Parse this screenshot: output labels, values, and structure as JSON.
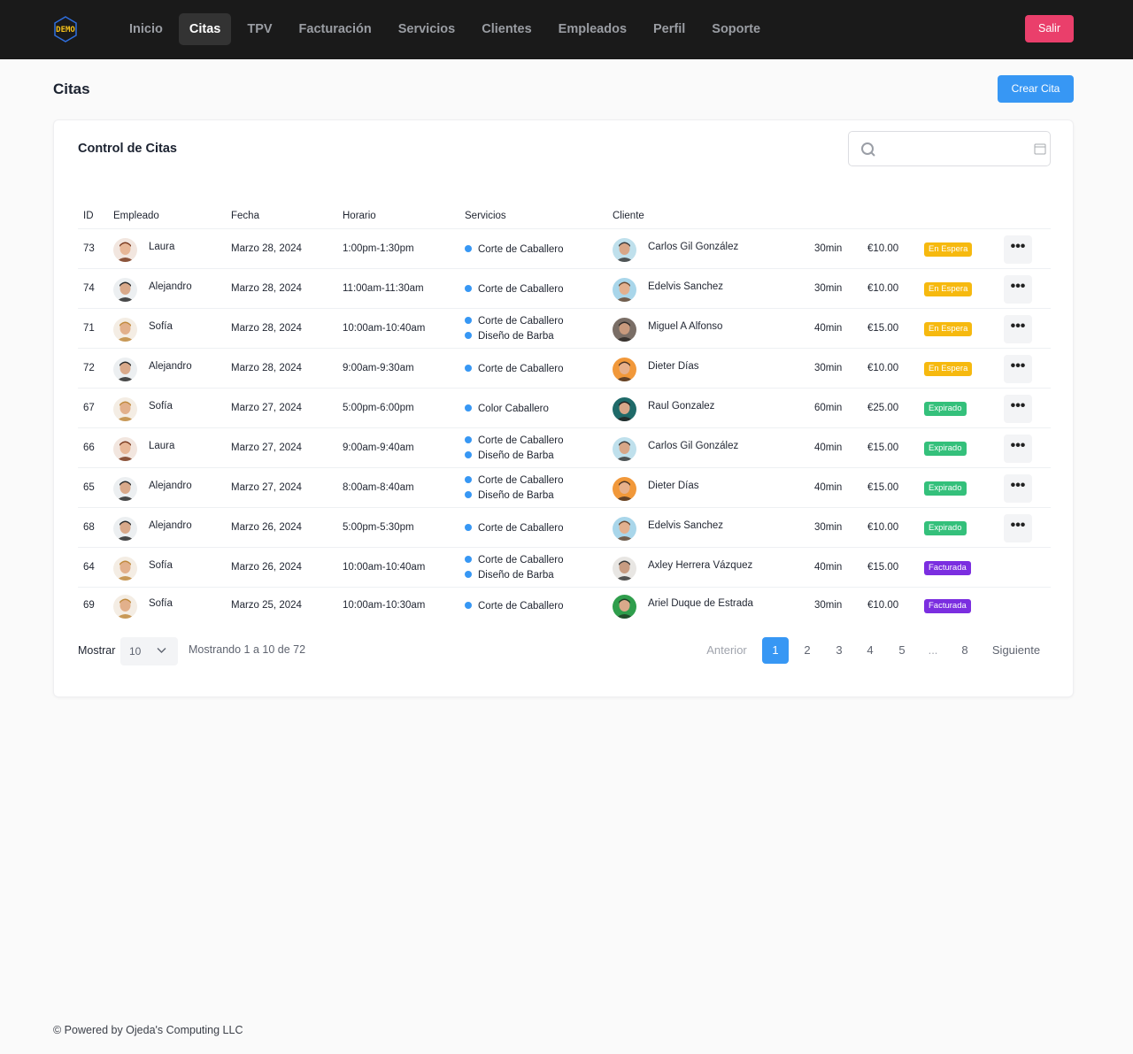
{
  "nav": {
    "logo_text": "DEMO",
    "items": [
      {
        "label": "Inicio",
        "active": false
      },
      {
        "label": "Citas",
        "active": true
      },
      {
        "label": "TPV",
        "active": false
      },
      {
        "label": "Facturación",
        "active": false
      },
      {
        "label": "Servicios",
        "active": false
      },
      {
        "label": "Clientes",
        "active": false
      },
      {
        "label": "Empleados",
        "active": false
      },
      {
        "label": "Perfil",
        "active": false
      },
      {
        "label": "Soporte",
        "active": false
      }
    ],
    "logout_label": "Salir"
  },
  "page": {
    "title": "Citas",
    "create_button": "Crear Cita"
  },
  "card": {
    "title": "Control de Citas",
    "search": {
      "value": "",
      "placeholder": ""
    }
  },
  "table": {
    "headers": {
      "id": "ID",
      "empleado": "Empleado",
      "fecha": "Fecha",
      "horario": "Horario",
      "servicios": "Servicios",
      "cliente": "Cliente"
    },
    "rows": [
      {
        "id": "73",
        "empleado": "Laura",
        "fecha": "Marzo 28, 2024",
        "horario": "1:00pm-1:30pm",
        "servicios": [
          "Corte de Caballero"
        ],
        "cliente": "Carlos Gil González",
        "duracion": "30min",
        "precio": "€10.00",
        "estado": "En Espera",
        "estado_tipo": "espera",
        "acciones": true
      },
      {
        "id": "74",
        "empleado": "Alejandro",
        "fecha": "Marzo 28, 2024",
        "horario": "11:00am-11:30am",
        "servicios": [
          "Corte de Caballero"
        ],
        "cliente": "Edelvis Sanchez",
        "duracion": "30min",
        "precio": "€10.00",
        "estado": "En Espera",
        "estado_tipo": "espera",
        "acciones": true
      },
      {
        "id": "71",
        "empleado": "Sofía",
        "fecha": "Marzo 28, 2024",
        "horario": "10:00am-10:40am",
        "servicios": [
          "Corte de Caballero",
          "Diseño de Barba"
        ],
        "cliente": "Miguel A Alfonso",
        "duracion": "40min",
        "precio": "€15.00",
        "estado": "En Espera",
        "estado_tipo": "espera",
        "acciones": true
      },
      {
        "id": "72",
        "empleado": "Alejandro",
        "fecha": "Marzo 28, 2024",
        "horario": "9:00am-9:30am",
        "servicios": [
          "Corte de Caballero"
        ],
        "cliente": "Dieter Días",
        "duracion": "30min",
        "precio": "€10.00",
        "estado": "En Espera",
        "estado_tipo": "espera",
        "acciones": true
      },
      {
        "id": "67",
        "empleado": "Sofía",
        "fecha": "Marzo 27, 2024",
        "horario": "5:00pm-6:00pm",
        "servicios": [
          "Color Caballero"
        ],
        "cliente": "Raul Gonzalez",
        "duracion": "60min",
        "precio": "€25.00",
        "estado": "Expirado",
        "estado_tipo": "expirado",
        "acciones": true
      },
      {
        "id": "66",
        "empleado": "Laura",
        "fecha": "Marzo 27, 2024",
        "horario": "9:00am-9:40am",
        "servicios": [
          "Corte de Caballero",
          "Diseño de Barba"
        ],
        "cliente": "Carlos Gil González",
        "duracion": "40min",
        "precio": "€15.00",
        "estado": "Expirado",
        "estado_tipo": "expirado",
        "acciones": true
      },
      {
        "id": "65",
        "empleado": "Alejandro",
        "fecha": "Marzo 27, 2024",
        "horario": "8:00am-8:40am",
        "servicios": [
          "Corte de Caballero",
          "Diseño de Barba"
        ],
        "cliente": "Dieter Días",
        "duracion": "40min",
        "precio": "€15.00",
        "estado": "Expirado",
        "estado_tipo": "expirado",
        "acciones": true
      },
      {
        "id": "68",
        "empleado": "Alejandro",
        "fecha": "Marzo 26, 2024",
        "horario": "5:00pm-5:30pm",
        "servicios": [
          "Corte de Caballero"
        ],
        "cliente": "Edelvis Sanchez",
        "duracion": "30min",
        "precio": "€10.00",
        "estado": "Expirado",
        "estado_tipo": "expirado",
        "acciones": true
      },
      {
        "id": "64",
        "empleado": "Sofía",
        "fecha": "Marzo 26, 2024",
        "horario": "10:00am-10:40am",
        "servicios": [
          "Corte de Caballero",
          "Diseño de Barba"
        ],
        "cliente": "Axley Herrera Vázquez",
        "duracion": "40min",
        "precio": "€15.00",
        "estado": "Facturada",
        "estado_tipo": "facturada",
        "acciones": false
      },
      {
        "id": "69",
        "empleado": "Sofía",
        "fecha": "Marzo 25, 2024",
        "horario": "10:00am-10:30am",
        "servicios": [
          "Corte de Caballero"
        ],
        "cliente": "Ariel Duque de Estrada",
        "duracion": "30min",
        "precio": "€10.00",
        "estado": "Facturada",
        "estado_tipo": "facturada",
        "acciones": false
      }
    ]
  },
  "pagination": {
    "show_label": "Mostrar",
    "page_size": "10",
    "info": "Mostrando 1 a 10 de 72",
    "prev": "Anterior",
    "pages": [
      "1",
      "2",
      "3",
      "4",
      "5",
      "...",
      "8"
    ],
    "current": "1",
    "next": "Siguiente"
  },
  "footer": {
    "text": "© Powered by Ojeda's Computing LLC"
  },
  "colors": {
    "accent": "#3797f4",
    "danger": "#ea3f6b",
    "waiting": "#f6b90f",
    "expired": "#34c07b",
    "invoiced": "#7b2ee0"
  }
}
